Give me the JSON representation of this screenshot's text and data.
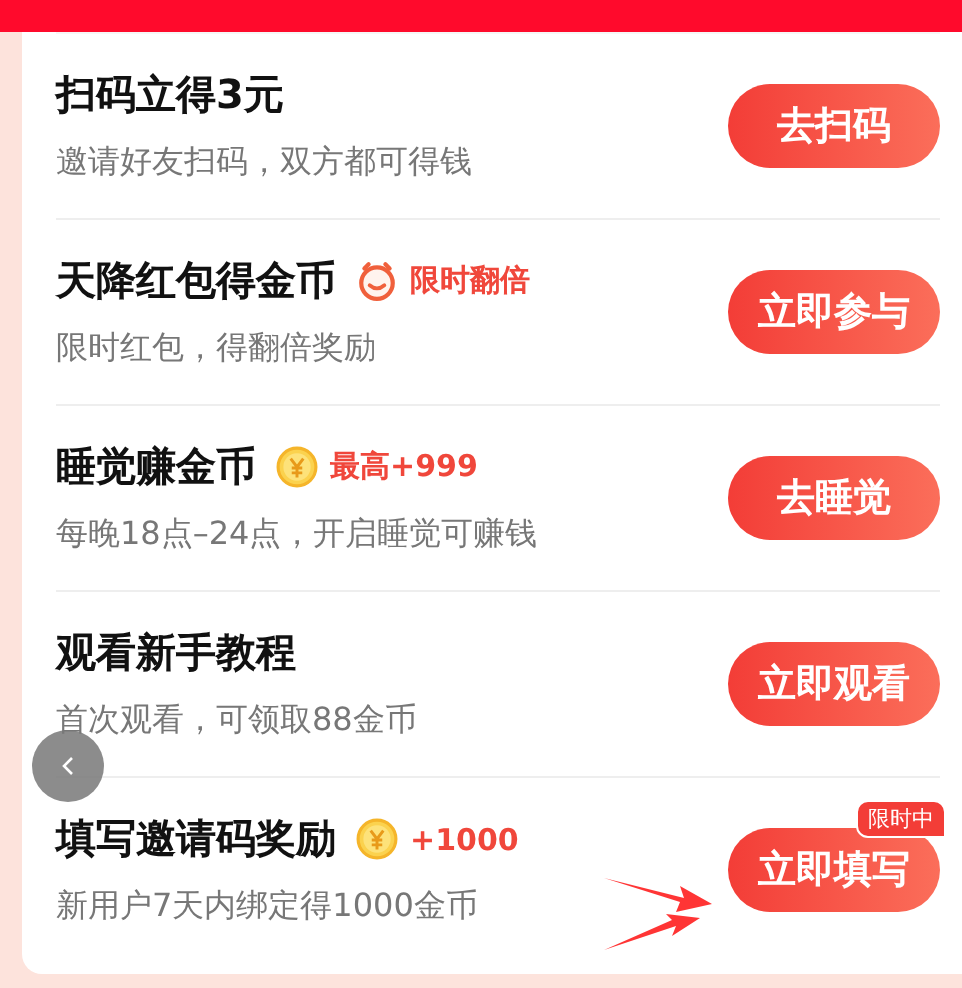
{
  "tasks": [
    {
      "title": "扫码立得3元",
      "subtitle": "邀请好友扫码，双方都可得钱",
      "button": {
        "label": "去扫码"
      }
    },
    {
      "title": "天降红包得金币",
      "badge": {
        "kind": "timer",
        "text": "限时翻倍"
      },
      "subtitle": "限时红包，得翻倍奖励",
      "button": {
        "label": "立即参与"
      }
    },
    {
      "title": "睡觉赚金币",
      "badge": {
        "kind": "coin",
        "text": "最高+999"
      },
      "subtitle": "每晚18点–24点，开启睡觉可赚钱",
      "button": {
        "label": "去睡觉"
      }
    },
    {
      "title": "观看新手教程",
      "subtitle": "首次观看，可领取88金币",
      "button": {
        "label": "立即观看"
      }
    },
    {
      "title": "填写邀请码奖励",
      "badge": {
        "kind": "coin",
        "text": "+1000"
      },
      "subtitle": "新用户7天内绑定得1000金币",
      "button": {
        "label": "立即填写",
        "tag": "限时中"
      }
    }
  ]
}
